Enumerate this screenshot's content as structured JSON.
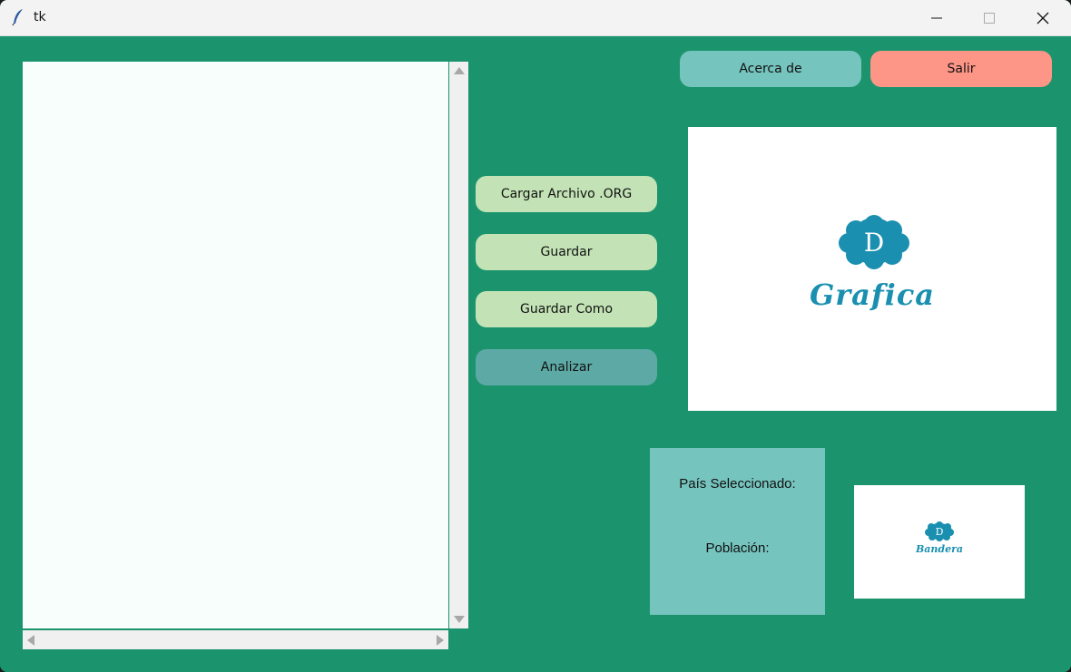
{
  "window": {
    "title": "tk",
    "controls": [
      "minimize",
      "maximize",
      "close"
    ],
    "background_color": "#1b946d"
  },
  "toolbar": {
    "about_label": "Acerca de",
    "exit_label": "Salir",
    "about_color": "#76c4be",
    "exit_color": "#fe9687"
  },
  "actions": {
    "load_label": "Cargar Archivo .ORG",
    "save_label": "Guardar",
    "save_as_label": "Guardar Como",
    "analyze_label": "Analizar"
  },
  "editor": {
    "content": ""
  },
  "graph_panel": {
    "logo_letter": "D",
    "caption": "Grafica"
  },
  "info_panel": {
    "country_label": "País Seleccionado:",
    "population_label": "Población:"
  },
  "flag_panel": {
    "logo_letter": "D",
    "caption": "Bandera"
  },
  "icons": {
    "app": "feather-icon",
    "minimize": "minimize-icon",
    "maximize": "maximize-icon",
    "close": "close-icon"
  }
}
